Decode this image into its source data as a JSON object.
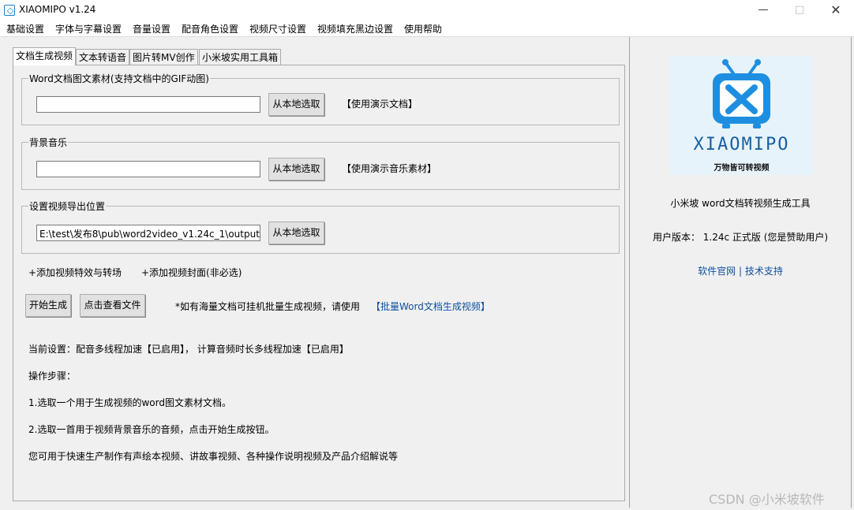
{
  "window": {
    "title": "XIAOMIPO v1.24"
  },
  "menu": [
    "基础设置",
    "字体与字幕设置",
    "音量设置",
    "配音角色设置",
    "视频尺寸设置",
    "视频填充黑边设置",
    "使用帮助"
  ],
  "tabs": [
    "文档生成视频",
    "文本转语音",
    "图片转MV创作",
    "小米坡实用工具箱"
  ],
  "groups": {
    "word": {
      "legend": "Word文档图文素材(支持文档中的GIF动图)",
      "value": "",
      "button": "从本地选取",
      "link": "【使用演示文档】"
    },
    "music": {
      "legend": "背景音乐",
      "value": "",
      "button": "从本地选取",
      "link": "【使用演示音乐素材】"
    },
    "output": {
      "legend": "设置视频导出位置",
      "value": "E:\\test\\发布8\\pub\\word2video_v1.24c_1\\output",
      "button": "从本地选取"
    }
  },
  "options": {
    "effects": "+添加视频特效与转场",
    "cover": "+添加视频封面(非必选)"
  },
  "actions": {
    "start": "开始生成",
    "view": "点击查看文件",
    "batch_note": "*如有海量文档可挂机批量生成视频，请使用",
    "batch_link": "【批量Word文档生成视频】"
  },
  "info": {
    "current": "当前设置：配音多线程加速【已启用】， 计算音频时长多线程加速【已启用】",
    "steps_title": "操作步骤：",
    "step1": "1.选取一个用于生成视频的word图文素材文档。",
    "step2": "2.选取一首用于视频背景音乐的音频，点击开始生成按钮。",
    "usage": "您可用于快速生产制作有声绘本视频、讲故事视频、各种操作说明视频及产品介绍解说等"
  },
  "sidebar": {
    "logo_text": "XIAOMIPO",
    "logo_slogan": "万物皆可转视频",
    "product": "小米坡 word文档转视频生成工具",
    "version": "用户版本： 1.24c 正式版 (您是赞助用户)",
    "link_site": "软件官网",
    "link_sep": "|",
    "link_support": "技术支持"
  },
  "watermark": "CSDN @小米坡软件",
  "colors": {
    "logo_blue": "#1e8fe0",
    "link_blue": "#0b4f9e"
  }
}
